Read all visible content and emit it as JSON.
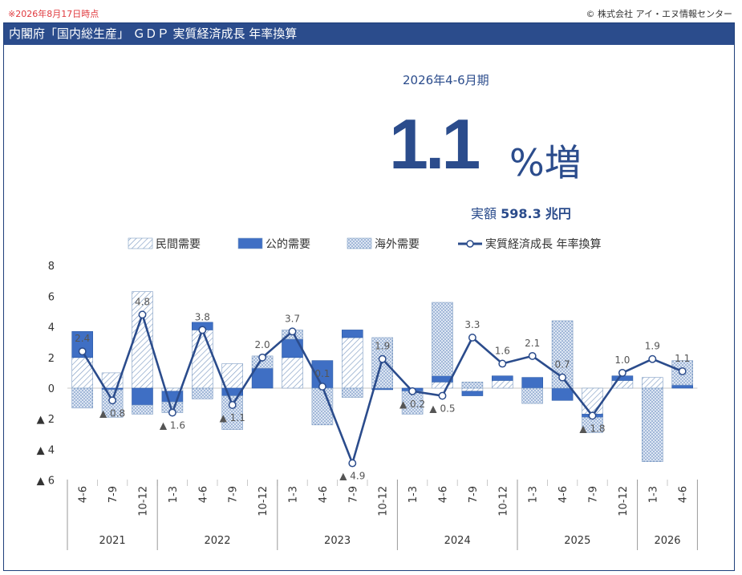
{
  "header": {
    "note": "※2026年8月17日時点",
    "copyright": "© 株式会社 アイ・エヌ情報センター",
    "title": "内閣府「国内総生産」 ＧＤＰ 実質経済成長 年率換算"
  },
  "headline": {
    "period": "2026年4-6月期",
    "value": "1.1",
    "unit": "%増",
    "amount_label": "実額",
    "amount_value": "598.3",
    "amount_unit": "兆円"
  },
  "colors": {
    "accent": "#2b4c8c",
    "public": "#3f6fc4",
    "private_hatch": "#7f9dc4",
    "foreign_hatch": "#5d82b8",
    "line": "#2b4c8c"
  },
  "chart_data": {
    "type": "bar",
    "stacked": true,
    "quarters": [
      "4-6",
      "7-9",
      "10-12",
      "1-3",
      "4-6",
      "7-9",
      "10-12",
      "1-3",
      "4-6",
      "7-9",
      "10-12",
      "1-3",
      "4-6",
      "7-9",
      "10-12",
      "1-3",
      "4-6",
      "7-9",
      "10-12",
      "1-3",
      "4-6"
    ],
    "years": [
      {
        "label": "2021",
        "count": 3
      },
      {
        "label": "2022",
        "count": 4
      },
      {
        "label": "2023",
        "count": 4
      },
      {
        "label": "2024",
        "count": 4
      },
      {
        "label": "2025",
        "count": 4
      },
      {
        "label": "2026",
        "count": 2
      }
    ],
    "series": [
      {
        "name": "民間需要",
        "values": [
          2.0,
          1.0,
          6.3,
          -0.2,
          3.8,
          1.6,
          0.0,
          2.0,
          0.0,
          3.3,
          0.0,
          0.0,
          0.4,
          -0.2,
          0.5,
          0.0,
          0.0,
          -1.7,
          0.5,
          0.7,
          0.0
        ]
      },
      {
        "name": "公的需要",
        "values": [
          1.7,
          -0.1,
          -1.1,
          -0.7,
          0.5,
          -0.5,
          1.3,
          1.2,
          1.8,
          0.5,
          -0.1,
          -0.2,
          0.4,
          -0.3,
          0.3,
          0.7,
          -0.8,
          -0.2,
          0.3,
          0.0,
          0.2
        ]
      },
      {
        "name": "海外需要",
        "values": [
          -1.3,
          -1.8,
          -0.6,
          -0.7,
          -0.7,
          -2.2,
          0.8,
          0.6,
          -2.4,
          -0.6,
          3.3,
          -1.5,
          4.8,
          0.4,
          0.0,
          -1.0,
          4.4,
          -1.0,
          0.0,
          -4.8,
          1.6
        ]
      },
      {
        "name": "実質経済成長 年率換算",
        "values": [
          2.4,
          -0.8,
          4.8,
          -1.6,
          3.8,
          -1.1,
          2.0,
          3.7,
          0.1,
          -4.9,
          1.9,
          -0.2,
          -0.5,
          3.3,
          1.6,
          2.1,
          0.7,
          -1.8,
          1.0,
          1.9,
          1.1
        ]
      }
    ],
    "yticks": [
      "8",
      "6",
      "4",
      "2",
      "0",
      "▲ 2",
      "▲ 4",
      "▲ 6"
    ],
    "ylim": [
      -6,
      8
    ]
  },
  "point_labels": [
    {
      "i": 0,
      "text": "2.4"
    },
    {
      "i": 1,
      "text": "▲ 0.8"
    },
    {
      "i": 2,
      "text": "4.8"
    },
    {
      "i": 3,
      "text": "▲ 1.6"
    },
    {
      "i": 4,
      "text": "3.8"
    },
    {
      "i": 5,
      "text": "▲ 1.1"
    },
    {
      "i": 6,
      "text": "2.0"
    },
    {
      "i": 7,
      "text": "3.7"
    },
    {
      "i": 8,
      "text": "0.1"
    },
    {
      "i": 9,
      "text": "▲ 4.9"
    },
    {
      "i": 10,
      "text": "1.9"
    },
    {
      "i": 11,
      "text": "▲ 0.2"
    },
    {
      "i": 12,
      "text": "▲ 0.5"
    },
    {
      "i": 13,
      "text": "3.3"
    },
    {
      "i": 14,
      "text": "1.6"
    },
    {
      "i": 15,
      "text": "2.1"
    },
    {
      "i": 16,
      "text": "0.7"
    },
    {
      "i": 17,
      "text": "▲ 1.8"
    },
    {
      "i": 18,
      "text": "1.0"
    },
    {
      "i": 19,
      "text": "1.9"
    },
    {
      "i": 20,
      "text": "1.1"
    }
  ]
}
